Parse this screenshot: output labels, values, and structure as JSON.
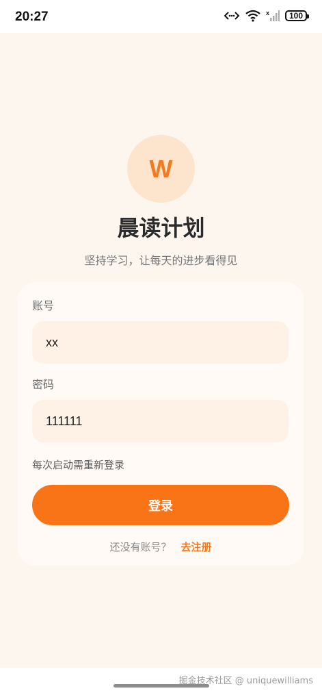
{
  "status_bar": {
    "time": "20:27",
    "battery": "100"
  },
  "logo": {
    "letter": "W"
  },
  "header": {
    "title": "晨读计划",
    "subtitle": "坚持学习，让每天的进步看得见"
  },
  "form": {
    "account_label": "账号",
    "account_value": "xx",
    "password_label": "密码",
    "password_value": "111111",
    "hint": "每次启动需重新登录",
    "login_button": "登录",
    "register_prompt": "还没有账号？",
    "register_link": "去注册"
  },
  "footer": {
    "watermark": "掘金技术社区 @ uniquewilliams"
  },
  "colors": {
    "accent": "#f97417",
    "background": "#fdf6ef",
    "field": "#fdf2e5",
    "logo_bg": "#fde4cc"
  }
}
